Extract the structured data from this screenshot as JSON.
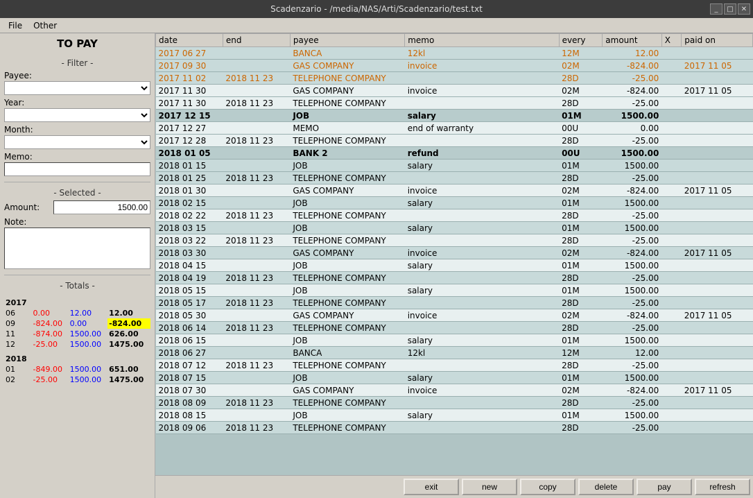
{
  "window": {
    "title": "Scadenzario - /media/NAS/Arti/Scadenzario/test.txt",
    "controls": [
      "_",
      "□",
      "✕"
    ]
  },
  "menubar": {
    "items": [
      "File",
      "Other"
    ]
  },
  "left_panel": {
    "title": "TO PAY",
    "filter_label": "- Filter -",
    "payee_label": "Payee:",
    "year_label": "Year:",
    "month_label": "Month:",
    "memo_label": "Memo:",
    "selected_label": "- Selected -",
    "amount_label": "Amount:",
    "amount_value": "1500.00",
    "note_label": "Note:",
    "totals_label": "- Totals -"
  },
  "totals": {
    "years": [
      {
        "year": "2017",
        "rows": [
          {
            "month": "06",
            "col1": "0.00",
            "col2": "12.00",
            "col3": "12.00",
            "col1_class": "t-neg",
            "col2_class": "t-pos",
            "col3_class": "t-bold"
          },
          {
            "month": "09",
            "col1": "-824.00",
            "col2": "0.00",
            "col3": "-824.00",
            "col1_class": "t-neg",
            "col2_class": "t-pos",
            "col3_class": "t-neg-bg"
          },
          {
            "month": "11",
            "col1": "-874.00",
            "col2": "1500.00",
            "col3": "626.00",
            "col1_class": "t-neg",
            "col2_class": "t-pos",
            "col3_class": "t-bold"
          },
          {
            "month": "12",
            "col1": "-25.00",
            "col2": "1500.00",
            "col3": "1475.00",
            "col1_class": "t-neg",
            "col2_class": "t-pos",
            "col3_class": "t-bold"
          }
        ]
      },
      {
        "year": "2018",
        "rows": [
          {
            "month": "01",
            "col1": "-849.00",
            "col2": "1500.00",
            "col3": "651.00",
            "col1_class": "t-neg",
            "col2_class": "t-pos",
            "col3_class": "t-bold"
          },
          {
            "month": "02",
            "col1": "-25.00",
            "col2": "1500.00",
            "col3": "1475.00",
            "col1_class": "t-neg",
            "col2_class": "t-pos",
            "col3_class": "t-bold"
          }
        ]
      }
    ]
  },
  "table": {
    "headers": [
      "date",
      "end",
      "payee",
      "memo",
      "every",
      "amount",
      "X",
      "paid on"
    ],
    "rows": [
      {
        "date": "2017 06 27",
        "end": "",
        "payee": "BANCA",
        "memo": "12kl",
        "every": "12M",
        "amount": "12.00",
        "x": "",
        "paidon": "",
        "date_class": "cell-orange",
        "payee_class": "cell-orange",
        "memo_class": "cell-orange",
        "every_class": "cell-orange",
        "amount_class": "cell-orange",
        "row_class": "row-highlight"
      },
      {
        "date": "2017 09 30",
        "end": "",
        "payee": "GAS COMPANY",
        "memo": "invoice",
        "every": "02M",
        "amount": "-824.00",
        "x": "",
        "paidon": "2017 11 05",
        "date_class": "cell-orange",
        "payee_class": "cell-orange",
        "memo_class": "cell-orange",
        "every_class": "cell-orange",
        "amount_class": "cell-orange",
        "paidon_class": "cell-orange",
        "row_class": "row-highlight"
      },
      {
        "date": "2017 11 02",
        "end": "2018 11 23",
        "payee": "TELEPHONE COMPANY",
        "memo": "",
        "every": "28D",
        "amount": "-25.00",
        "x": "",
        "paidon": "",
        "date_class": "cell-orange",
        "end_class": "cell-orange",
        "payee_class": "cell-orange",
        "every_class": "cell-orange",
        "amount_class": "cell-orange",
        "row_class": "row-highlight"
      },
      {
        "date": "2017 11 30",
        "end": "",
        "payee": "GAS COMPANY",
        "memo": "invoice",
        "every": "02M",
        "amount": "-824.00",
        "x": "",
        "paidon": "2017 11 05",
        "row_class": "row-white"
      },
      {
        "date": "2017 11 30",
        "end": "2018 11 23",
        "payee": "TELEPHONE COMPANY",
        "memo": "",
        "every": "28D",
        "amount": "-25.00",
        "x": "",
        "paidon": "",
        "row_class": "row-white"
      },
      {
        "date": "2017 12 15",
        "end": "",
        "payee": "JOB",
        "memo": "salary",
        "every": "01M",
        "amount": "1500.00",
        "x": "",
        "paidon": "",
        "row_class": "row-selected-bold",
        "bold": true
      },
      {
        "date": "2017 12 27",
        "end": "",
        "payee": "MEMO",
        "memo": "end of warranty",
        "every": "00U",
        "amount": "0.00",
        "x": "",
        "paidon": "",
        "row_class": "row-white"
      },
      {
        "date": "2017 12 28",
        "end": "2018 11 23",
        "payee": "TELEPHONE COMPANY",
        "memo": "",
        "every": "28D",
        "amount": "-25.00",
        "x": "",
        "paidon": "",
        "row_class": "row-white"
      },
      {
        "date": "2018 01 05",
        "end": "",
        "payee": "BANK 2",
        "memo": "refund",
        "every": "00U",
        "amount": "1500.00",
        "x": "",
        "paidon": "",
        "row_class": "row-selected-bold",
        "bold": true
      },
      {
        "date": "2018 01 15",
        "end": "",
        "payee": "JOB",
        "memo": "salary",
        "every": "01M",
        "amount": "1500.00",
        "x": "",
        "paidon": "",
        "row_class": "row-highlight"
      },
      {
        "date": "2018 01 25",
        "end": "2018 11 23",
        "payee": "TELEPHONE COMPANY",
        "memo": "",
        "every": "28D",
        "amount": "-25.00",
        "x": "",
        "paidon": "",
        "row_class": "row-highlight"
      },
      {
        "date": "2018 01 30",
        "end": "",
        "payee": "GAS COMPANY",
        "memo": "invoice",
        "every": "02M",
        "amount": "-824.00",
        "x": "",
        "paidon": "2017 11 05",
        "row_class": "row-white"
      },
      {
        "date": "2018 02 15",
        "end": "",
        "payee": "JOB",
        "memo": "salary",
        "every": "01M",
        "amount": "1500.00",
        "x": "",
        "paidon": "",
        "row_class": "row-highlight"
      },
      {
        "date": "2018 02 22",
        "end": "2018 11 23",
        "payee": "TELEPHONE COMPANY",
        "memo": "",
        "every": "28D",
        "amount": "-25.00",
        "x": "",
        "paidon": "",
        "row_class": "row-white"
      },
      {
        "date": "2018 03 15",
        "end": "",
        "payee": "JOB",
        "memo": "salary",
        "every": "01M",
        "amount": "1500.00",
        "x": "",
        "paidon": "",
        "row_class": "row-highlight"
      },
      {
        "date": "2018 03 22",
        "end": "2018 11 23",
        "payee": "TELEPHONE COMPANY",
        "memo": "",
        "every": "28D",
        "amount": "-25.00",
        "x": "",
        "paidon": "",
        "row_class": "row-white"
      },
      {
        "date": "2018 03 30",
        "end": "",
        "payee": "GAS COMPANY",
        "memo": "invoice",
        "every": "02M",
        "amount": "-824.00",
        "x": "",
        "paidon": "2017 11 05",
        "row_class": "row-highlight"
      },
      {
        "date": "2018 04 15",
        "end": "",
        "payee": "JOB",
        "memo": "salary",
        "every": "01M",
        "amount": "1500.00",
        "x": "",
        "paidon": "",
        "row_class": "row-white"
      },
      {
        "date": "2018 04 19",
        "end": "2018 11 23",
        "payee": "TELEPHONE COMPANY",
        "memo": "",
        "every": "28D",
        "amount": "-25.00",
        "x": "",
        "paidon": "",
        "row_class": "row-highlight"
      },
      {
        "date": "2018 05 15",
        "end": "",
        "payee": "JOB",
        "memo": "salary",
        "every": "01M",
        "amount": "1500.00",
        "x": "",
        "paidon": "",
        "row_class": "row-white"
      },
      {
        "date": "2018 05 17",
        "end": "2018 11 23",
        "payee": "TELEPHONE COMPANY",
        "memo": "",
        "every": "28D",
        "amount": "-25.00",
        "x": "",
        "paidon": "",
        "row_class": "row-highlight"
      },
      {
        "date": "2018 05 30",
        "end": "",
        "payee": "GAS COMPANY",
        "memo": "invoice",
        "every": "02M",
        "amount": "-824.00",
        "x": "",
        "paidon": "2017 11 05",
        "row_class": "row-white"
      },
      {
        "date": "2018 06 14",
        "end": "2018 11 23",
        "payee": "TELEPHONE COMPANY",
        "memo": "",
        "every": "28D",
        "amount": "-25.00",
        "x": "",
        "paidon": "",
        "row_class": "row-highlight"
      },
      {
        "date": "2018 06 15",
        "end": "",
        "payee": "JOB",
        "memo": "salary",
        "every": "01M",
        "amount": "1500.00",
        "x": "",
        "paidon": "",
        "row_class": "row-white"
      },
      {
        "date": "2018 06 27",
        "end": "",
        "payee": "BANCA",
        "memo": "12kl",
        "every": "12M",
        "amount": "12.00",
        "x": "",
        "paidon": "",
        "row_class": "row-highlight"
      },
      {
        "date": "2018 07 12",
        "end": "2018 11 23",
        "payee": "TELEPHONE COMPANY",
        "memo": "",
        "every": "28D",
        "amount": "-25.00",
        "x": "",
        "paidon": "",
        "row_class": "row-white"
      },
      {
        "date": "2018 07 15",
        "end": "",
        "payee": "JOB",
        "memo": "salary",
        "every": "01M",
        "amount": "1500.00",
        "x": "",
        "paidon": "",
        "row_class": "row-highlight"
      },
      {
        "date": "2018 07 30",
        "end": "",
        "payee": "GAS COMPANY",
        "memo": "invoice",
        "every": "02M",
        "amount": "-824.00",
        "x": "",
        "paidon": "2017 11 05",
        "row_class": "row-white"
      },
      {
        "date": "2018 08 09",
        "end": "2018 11 23",
        "payee": "TELEPHONE COMPANY",
        "memo": "",
        "every": "28D",
        "amount": "-25.00",
        "x": "",
        "paidon": "",
        "row_class": "row-highlight"
      },
      {
        "date": "2018 08 15",
        "end": "",
        "payee": "JOB",
        "memo": "salary",
        "every": "01M",
        "amount": "1500.00",
        "x": "",
        "paidon": "",
        "row_class": "row-white"
      },
      {
        "date": "2018 09 06",
        "end": "2018 11 23",
        "payee": "TELEPHONE COMPANY",
        "memo": "",
        "every": "28D",
        "amount": "-25.00",
        "x": "",
        "paidon": "",
        "row_class": "row-highlight"
      }
    ]
  },
  "buttons": {
    "exit": "exit",
    "new": "new",
    "copy": "copy",
    "delete": "delete",
    "pay": "pay",
    "refresh": "refresh"
  }
}
